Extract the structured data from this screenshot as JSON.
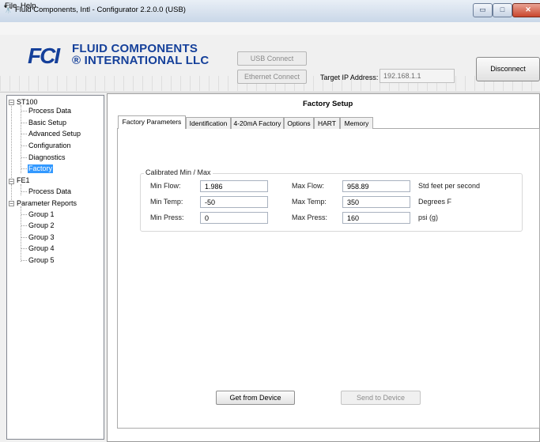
{
  "window": {
    "app_icon": "binoculars-icon",
    "title": "Fluid Components, Intl - Configurator 2.2.0.0 (USB)",
    "min_glyph": "▭",
    "max_glyph": "□",
    "close_glyph": "✕"
  },
  "menu": {
    "file": "File",
    "help": "Help"
  },
  "header": {
    "logo_mark": "FCI",
    "logo_line1": "FLUID COMPONENTS",
    "logo_line2": "® INTERNATIONAL LLC",
    "usb_connect": "USB Connect",
    "ethernet_connect": "Ethernet Connect",
    "ip_label": "Target IP Address:",
    "ip_value": "192.168.1.1",
    "disconnect": "Disconnect"
  },
  "tree": {
    "st100": "ST100",
    "process_data_1": "Process Data",
    "basic_setup": "Basic Setup",
    "advanced_setup": "Advanced Setup",
    "configuration": "Configuration",
    "diagnostics": "Diagnostics",
    "factory": "Factory",
    "fe1": "FE1",
    "process_data_2": "Process Data",
    "parameter_reports": "Parameter Reports",
    "group1": "Group 1",
    "group2": "Group 2",
    "group3": "Group 3",
    "group4": "Group 4",
    "group5": "Group 5",
    "collapse_glyph": "−"
  },
  "panel": {
    "title": "Factory Setup",
    "tabs": {
      "factory_parameters": "Factory Parameters",
      "identification": "Identification",
      "factory_4_20": "4-20mA Factory",
      "options": "Options",
      "hart": "HART",
      "memory": "Memory"
    },
    "group_title": "Calibrated Min / Max",
    "min_flow_label": "Min Flow:",
    "min_flow": "1.986",
    "max_flow_label": "Max Flow:",
    "max_flow": "958.89",
    "flow_unit": "Std feet per second",
    "min_temp_label": "Min Temp:",
    "min_temp": "-50",
    "max_temp_label": "Max Temp:",
    "max_temp": "350",
    "temp_unit": "Degrees F",
    "min_press_label": "Min Press:",
    "min_press": "0",
    "max_press_label": "Max Press:",
    "max_press": "160",
    "press_unit": "psi (g)",
    "get_button": "Get from Device",
    "send_button": "Send to Device"
  }
}
